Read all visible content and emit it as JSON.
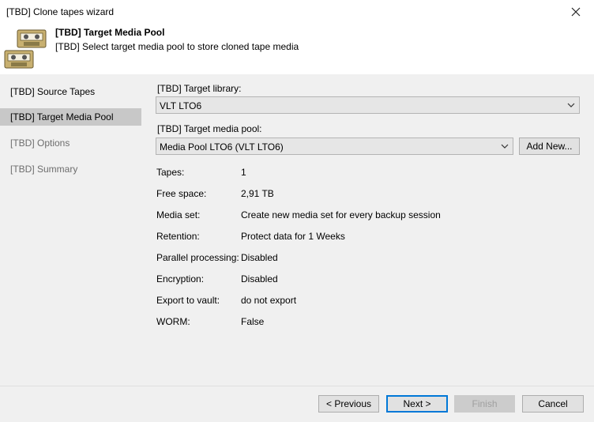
{
  "window": {
    "title": "[TBD] Clone tapes wizard"
  },
  "header": {
    "title": "[TBD] Target Media Pool",
    "subtitle": "[TBD] Select target media pool to store cloned tape media",
    "icon": "tape-cassette-icon"
  },
  "nav": {
    "items": [
      {
        "label": "[TBD] Source Tapes",
        "state": "normal"
      },
      {
        "label": "[TBD] Target Media Pool",
        "state": "active"
      },
      {
        "label": "[TBD] Options",
        "state": "disabled"
      },
      {
        "label": "[TBD] Summary",
        "state": "disabled"
      }
    ]
  },
  "form": {
    "library_label": "[TBD] Target library:",
    "library_value": "VLT LTO6",
    "pool_label": "[TBD] Target media pool:",
    "pool_value": "Media Pool LTO6 (VLT LTO6)",
    "add_new_label": "Add New..."
  },
  "properties": [
    {
      "key": "Tapes:",
      "value": "1"
    },
    {
      "key": "Free space:",
      "value": "2,91 TB"
    },
    {
      "key": "Media set:",
      "value": "Create new media set for every backup session"
    },
    {
      "key": "Retention:",
      "value": "Protect data for 1 Weeks"
    },
    {
      "key": "Parallel processing:",
      "value": "Disabled"
    },
    {
      "key": "Encryption:",
      "value": "Disabled"
    },
    {
      "key": "Export to vault:",
      "value": "do not export"
    },
    {
      "key": "WORM:",
      "value": "False"
    }
  ],
  "footer": {
    "previous_label": "< Previous",
    "next_label": "Next >",
    "finish_label": "Finish",
    "cancel_label": "Cancel"
  },
  "colors": {
    "pane_bg": "#f0f0f0",
    "active_nav": "#c8c8c8",
    "primary_border": "#0078d7",
    "tape_body": "#c8b070"
  }
}
